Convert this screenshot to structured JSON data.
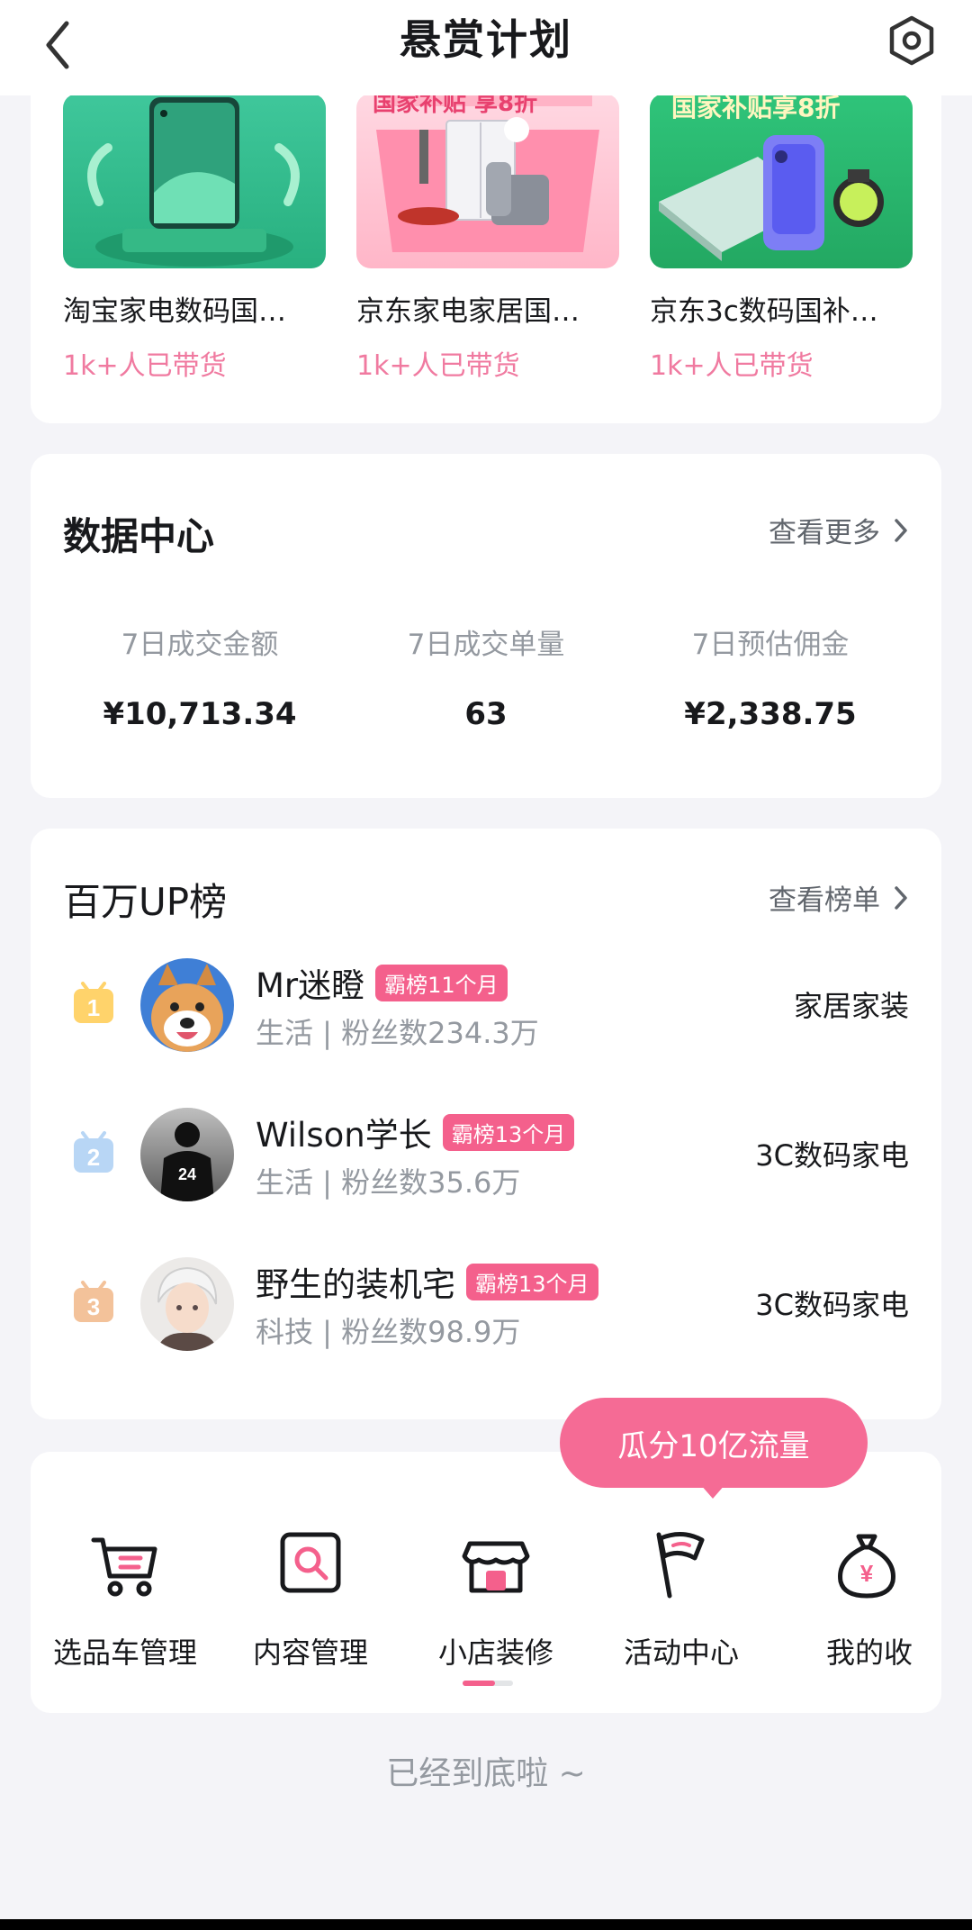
{
  "header": {
    "title": "悬赏计划",
    "back_icon": "chevron-left-icon",
    "settings_icon": "hexagon-settings-icon"
  },
  "products": [
    {
      "name": "淘宝家电数码国…",
      "sold": "1k+人已带货",
      "banner": ""
    },
    {
      "name": "京东家电家居国…",
      "sold": "1k+人已带货",
      "banner": "国家补贴 享8折"
    },
    {
      "name": "京东3c数码国补…",
      "sold": "1k+人已带货",
      "banner": "国家补贴享8折"
    }
  ],
  "data_center": {
    "title": "数据中心",
    "more": "查看更多",
    "stats": [
      {
        "label": "7日成交金额",
        "value": "¥10,713.34"
      },
      {
        "label": "7日成交单量",
        "value": "63"
      },
      {
        "label": "7日预估佣金",
        "value": "¥2,338.75"
      }
    ]
  },
  "ranking": {
    "title": "百万UP榜",
    "more": "查看榜单",
    "items": [
      {
        "rank": "1",
        "name": "Mr迷瞪",
        "tag": "霸榜11个月",
        "meta": "生活 | 粉丝数234.3万",
        "category": "家居家装"
      },
      {
        "rank": "2",
        "name": "Wilson学长",
        "tag": "霸榜13个月",
        "meta": "生活 | 粉丝数35.6万",
        "category": "3C数码家电"
      },
      {
        "rank": "3",
        "name": "野生的装机宅",
        "tag": "霸榜13个月",
        "meta": "科技 | 粉丝数98.9万",
        "category": "3C数码家电"
      }
    ]
  },
  "tools": {
    "bubble": "瓜分10亿流量",
    "items": [
      {
        "label": "选品车管理",
        "icon": "cart-icon"
      },
      {
        "label": "内容管理",
        "icon": "search-box-icon"
      },
      {
        "label": "小店装修",
        "icon": "shop-icon"
      },
      {
        "label": "活动中心",
        "icon": "flag-icon"
      },
      {
        "label": "我的收",
        "icon": "money-bag-icon"
      }
    ]
  },
  "footer": {
    "text": "已经到底啦 ~"
  },
  "colors": {
    "accent": "#f4608c",
    "muted": "#9499a0",
    "background": "#f4f4f8"
  }
}
